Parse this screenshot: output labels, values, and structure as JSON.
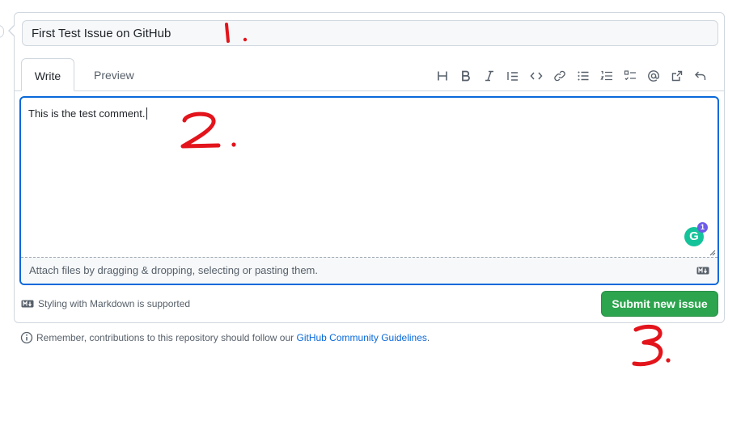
{
  "issue": {
    "title_value": "First Test Issue on GitHub"
  },
  "tabs": [
    {
      "label": "Write",
      "active": true
    },
    {
      "label": "Preview",
      "active": false
    }
  ],
  "toolbar_icons": [
    "heading-icon",
    "bold-icon",
    "italic-icon",
    "quote-icon",
    "code-icon",
    "link-icon",
    "unordered-list-icon",
    "ordered-list-icon",
    "task-list-icon",
    "mention-icon",
    "cross-reference-icon",
    "undo-icon"
  ],
  "comment": {
    "text": "This is the test comment.",
    "attach_text": "Attach files by dragging & dropping, selecting or pasting them."
  },
  "grammarly": {
    "badge_count": "1",
    "letter": "G"
  },
  "footer": {
    "markdown_note": "Styling with Markdown is supported",
    "submit_label": "Submit new issue",
    "guidelines_prefix": "Remember, contributions to this repository should follow our ",
    "guidelines_link": "GitHub Community Guidelines",
    "guidelines_suffix": "."
  },
  "annotations": [
    "1.",
    "2.",
    "3."
  ],
  "colors": {
    "accent_blue": "#0969da",
    "submit_green": "#2da44e",
    "annotation_red": "#e3141b",
    "grammarly_green": "#15c39a"
  }
}
